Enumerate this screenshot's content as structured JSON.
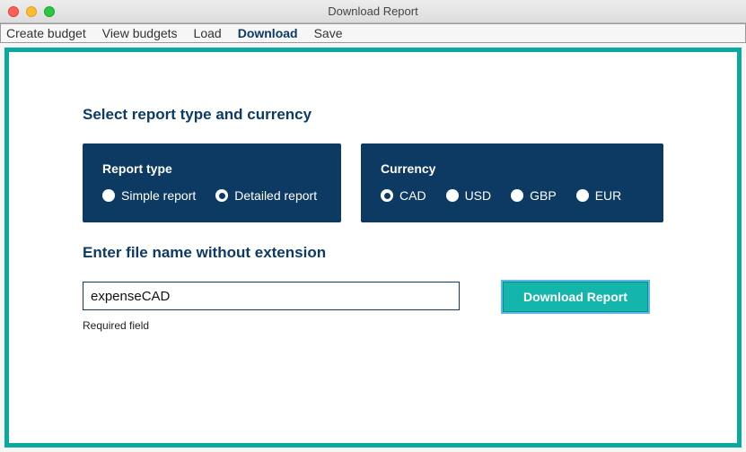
{
  "window": {
    "title": "Download Report"
  },
  "menubar": {
    "items": [
      {
        "label": "Create budget",
        "active": false
      },
      {
        "label": "View budgets",
        "active": false
      },
      {
        "label": "Load",
        "active": false
      },
      {
        "label": "Download",
        "active": true
      },
      {
        "label": "Save",
        "active": false
      }
    ]
  },
  "headings": {
    "section1": "Select report type and currency",
    "section2": "Enter file name without extension"
  },
  "report_type": {
    "title": "Report type",
    "options": [
      {
        "label": "Simple report",
        "selected": false
      },
      {
        "label": "Detailed report",
        "selected": true
      }
    ]
  },
  "currency": {
    "title": "Currency",
    "options": [
      {
        "label": "CAD",
        "selected": true
      },
      {
        "label": "USD",
        "selected": false
      },
      {
        "label": "GBP",
        "selected": false
      },
      {
        "label": "EUR",
        "selected": false
      }
    ]
  },
  "filename": {
    "value": "expenseCAD",
    "helper": "Required field"
  },
  "buttons": {
    "download": "Download Report"
  },
  "colors": {
    "accent_teal": "#14b6ac",
    "panel_navy": "#0d3a63",
    "heading_navy": "#0d3b66",
    "frame_teal": "#0aa9a0"
  }
}
